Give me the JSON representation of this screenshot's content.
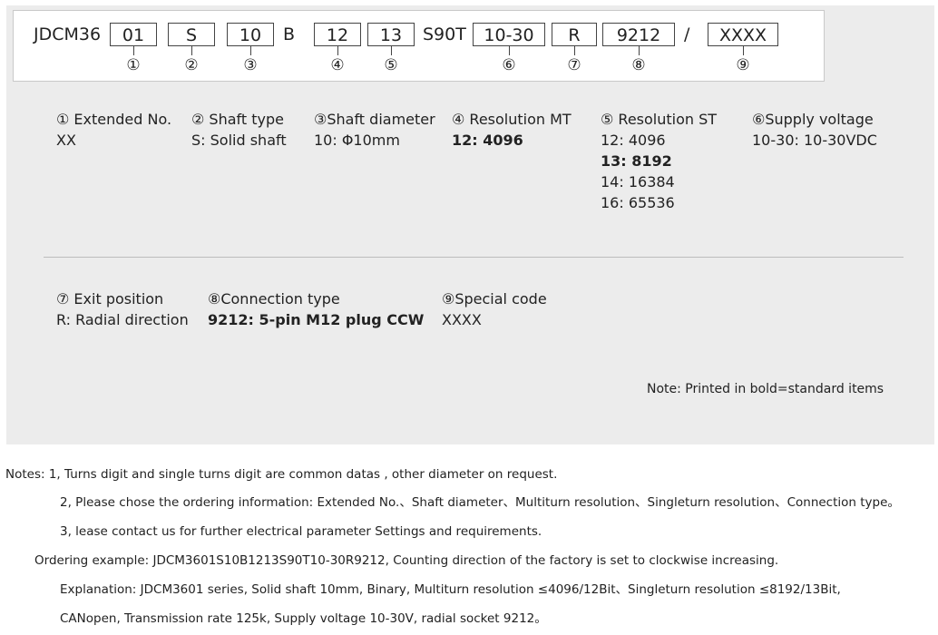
{
  "code": {
    "prefix": "JDCM36",
    "seg1": "01",
    "seg2": "S",
    "seg3": "10",
    "literal_b": "B",
    "seg4": "12",
    "seg5": "13",
    "literal_s90t": "S90T",
    "seg6": "10-30",
    "seg7": "R",
    "seg8": "9212",
    "slash": "/",
    "seg9": "XXXX",
    "markers": [
      "①",
      "②",
      "③",
      "④",
      "⑤",
      "⑥",
      "⑦",
      "⑧",
      "⑨"
    ]
  },
  "options": {
    "extended": {
      "title": "① Extended No.",
      "lines": [
        "XX"
      ]
    },
    "shaft_type": {
      "title": "② Shaft type",
      "lines": [
        "S: Solid shaft"
      ]
    },
    "shaft_diameter": {
      "title": "③Shaft diameter",
      "lines": [
        "10: Φ10mm"
      ]
    },
    "resolution_mt": {
      "title": "④ Resolution MT",
      "lines": [
        "12: 4096"
      ]
    },
    "resolution_st": {
      "title": "⑤ Resolution ST",
      "lines": [
        "12: 4096",
        "13: 8192",
        "14: 16384",
        "16: 65536"
      ]
    },
    "supply_voltage": {
      "title": "⑥Supply voltage",
      "lines": [
        "10-30: 10-30VDC"
      ]
    },
    "exit_position": {
      "title": "⑦ Exit position",
      "lines": [
        "R: Radial direction"
      ]
    },
    "connection_type": {
      "title": "⑧Connection type",
      "lines": [
        "9212: 5-pin M12 plug CCW"
      ]
    },
    "special_code": {
      "title": "⑨Special code",
      "lines": [
        "XXXX"
      ]
    }
  },
  "legend_note": "Note: Printed in bold=standard items",
  "notes": {
    "line1": "Notes: 1, Turns digit and single turns digit are common datas , other diameter on request.",
    "line2": "2, Please chose the ordering information: Extended No.、Shaft diameter、Multiturn resolution、Singleturn resolution、Connection type。",
    "line3": "3, lease contact us for further electrical parameter Settings and requirements.",
    "line4": "Ordering example: JDCM3601S10B1213S90T10-30R9212, Counting direction of the factory is set to clockwise increasing.",
    "line5": "Explanation: JDCM3601 series, Solid shaft 10mm, Binary, Multiturn resolution ≤4096/12Bit、Singleturn resolution ≤8192/13Bit,",
    "line6": "CANopen, Transmission rate 125k, Supply voltage 10-30V, radial socket 9212。"
  }
}
